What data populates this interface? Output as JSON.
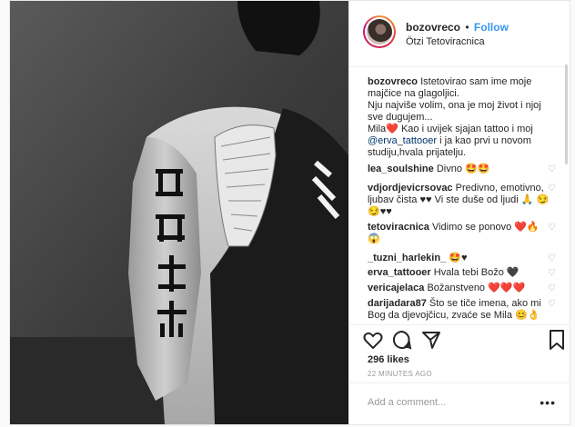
{
  "header": {
    "username": "bozovreco",
    "separator": "•",
    "follow_label": "Follow",
    "location": "Ötzi Tetoviracnica"
  },
  "caption": {
    "username": "bozovreco",
    "text1": "Istetovirao sam ime moje majčice na glagoljici.",
    "text2": "Nju najviše volim, ona je moj život i njoj sve dugujem...",
    "text3": "Mila",
    "heart": "❤️",
    "text4": "Kao i uvijek sjajan tattoo i moj",
    "mention": "@erva_tattooer",
    "text5": "i ja kao prvi u novom studiju,hvala prijatelju."
  },
  "comments": [
    {
      "user": "lea_soulshine",
      "text": "Divno 🤩🤩"
    },
    {
      "user": "vdjordjevicrsovac",
      "text": "Predivno, emotivno, ljubav čista ♥♥ Vi ste duše od ljudi 🙏 😏😏♥♥"
    },
    {
      "user": "tetoviracnica",
      "text": "Vidimo se ponovo ❤️🔥 😱"
    },
    {
      "user": "_tuzni_harlekin_",
      "text": "🤩♥"
    },
    {
      "user": "erva_tattooer",
      "text": "Hvala tebi Božo 🖤"
    },
    {
      "user": "vericajelaca",
      "text": "Božanstveno ❤️❤️❤️"
    },
    {
      "user": "darijadara87",
      "text": "Što se tiče imena, ako mi Bog da djevojčicu, zvaće se Mila 😊👌"
    }
  ],
  "likes": "296 likes",
  "timestamp": "22 MINUTES AGO",
  "add_comment": {
    "placeholder": "Add a comment...",
    "more": "•••"
  },
  "icons": [
    "heart-icon",
    "comment-icon",
    "share-icon",
    "bookmark-icon",
    "more-options-icon"
  ]
}
